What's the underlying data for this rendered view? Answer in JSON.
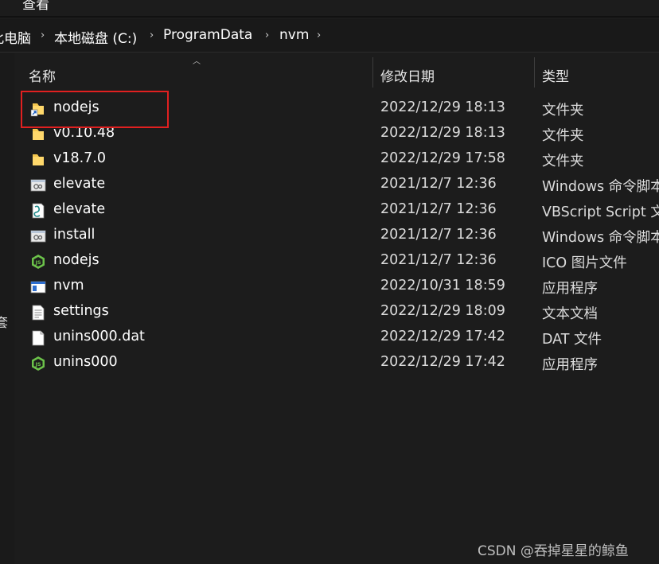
{
  "menu": {
    "view_label": "查看"
  },
  "breadcrumb": {
    "items": [
      "此电脑",
      "本地磁盘 (C:)",
      "ProgramData",
      "nvm"
    ],
    "separator": "›"
  },
  "nav": {
    "fragment": "套"
  },
  "columns": {
    "name": "名称",
    "date": "修改日期",
    "type": "类型"
  },
  "files": [
    {
      "name": "nodejs",
      "date": "2022/12/29 18:13",
      "type": "文件夹",
      "icon": "folder-shortcut-icon"
    },
    {
      "name": "v0.10.48",
      "date": "2022/12/29 18:13",
      "type": "文件夹",
      "icon": "folder-icon"
    },
    {
      "name": "v18.7.0",
      "date": "2022/12/29 17:58",
      "type": "文件夹",
      "icon": "folder-icon"
    },
    {
      "name": "elevate",
      "date": "2021/12/7 12:36",
      "type": "Windows 命令脚本",
      "icon": "cmd-script-icon"
    },
    {
      "name": "elevate",
      "date": "2021/12/7 12:36",
      "type": "VBScript Script 文",
      "icon": "vbscript-icon"
    },
    {
      "name": "install",
      "date": "2021/12/7 12:36",
      "type": "Windows 命令脚本",
      "icon": "cmd-script-icon"
    },
    {
      "name": "nodejs",
      "date": "2021/12/7 12:36",
      "type": "ICO 图片文件",
      "icon": "nodejs-icon"
    },
    {
      "name": "nvm",
      "date": "2022/10/31 18:59",
      "type": "应用程序",
      "icon": "app-window-icon"
    },
    {
      "name": "settings",
      "date": "2022/12/29 18:09",
      "type": "文本文档",
      "icon": "text-document-icon"
    },
    {
      "name": "unins000.dat",
      "date": "2022/12/29 17:42",
      "type": "DAT 文件",
      "icon": "blank-file-icon"
    },
    {
      "name": "unins000",
      "date": "2022/12/29 17:42",
      "type": "应用程序",
      "icon": "nodejs-icon"
    }
  ],
  "colors": {
    "background": "#1c1c1c",
    "highlight_border": "#e02020",
    "folder": "#f4c64e",
    "nodejs_green": "#6cc24a"
  },
  "watermark": "CSDN @吞掉星星的鲸鱼"
}
